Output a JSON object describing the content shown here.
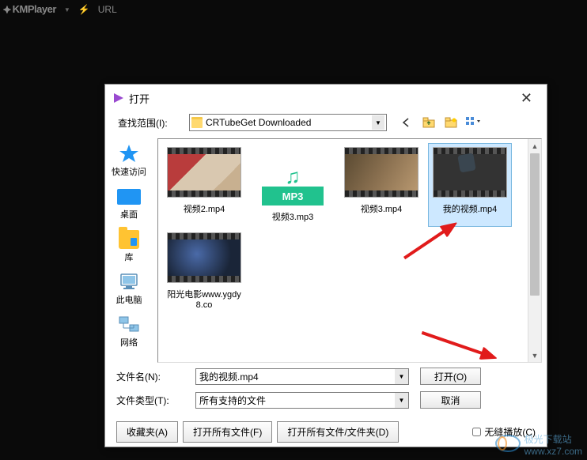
{
  "player": {
    "name": "KMPlayer",
    "url_label": "URL"
  },
  "dialog": {
    "title": "打开",
    "lookup_label": "查找范围(I):",
    "folder": "CRTubeGet Downloaded",
    "places": {
      "quick": "快速访问",
      "desktop": "桌面",
      "library": "库",
      "pc": "此电脑",
      "network": "网络"
    },
    "files": [
      {
        "name": "视频2.mp4",
        "type": "video",
        "thumb": "th-1"
      },
      {
        "name": "视频3.mp3",
        "type": "mp3"
      },
      {
        "name": "视频3.mp4",
        "type": "video",
        "thumb": "th-3"
      },
      {
        "name": "我的视频.mp4",
        "type": "video",
        "thumb": "th-4",
        "selected": true
      },
      {
        "name": "阳光电影www.ygdy8.co",
        "type": "folder",
        "thumb": "th-5"
      }
    ],
    "mp3_band": "MP3",
    "filename_label": "文件名(N):",
    "filename_value": "我的视频.mp4",
    "filetype_label": "文件类型(T):",
    "filetype_value": "所有支持的文件",
    "open_btn": "打开(O)",
    "cancel_btn": "取消",
    "footer": {
      "fav": "收藏夹(A)",
      "open_all": "打开所有文件(F)",
      "open_all_folder": "打开所有文件/文件夹(D)",
      "seamless": "无缝播放(C)"
    }
  },
  "watermark": "极光下载站\nwww.xz7.com"
}
